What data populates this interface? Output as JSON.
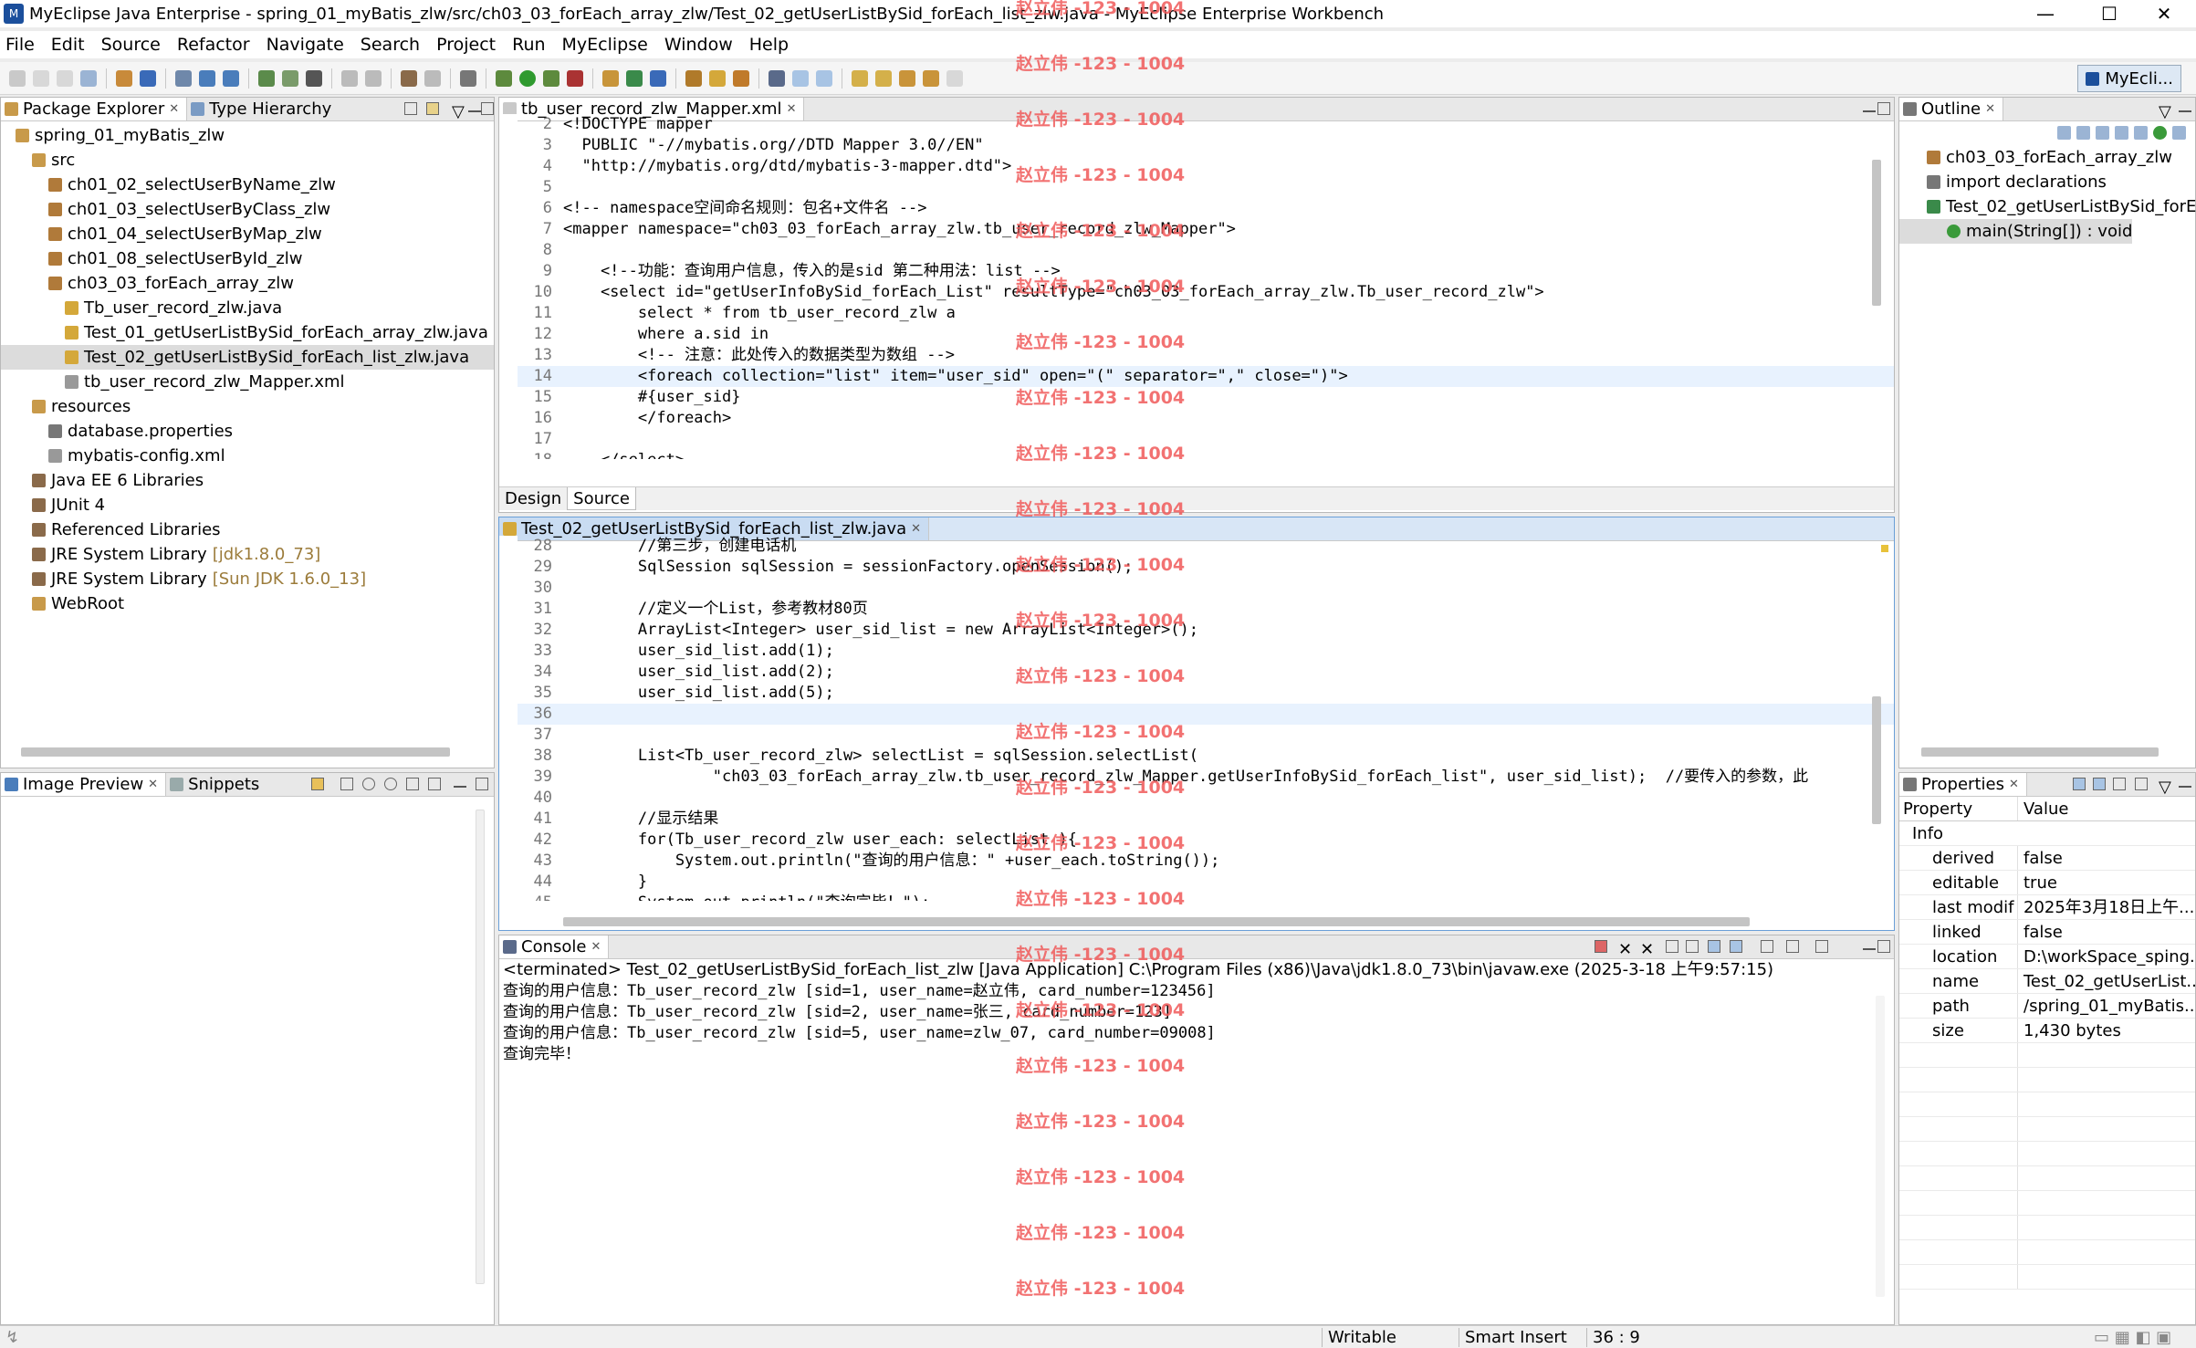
{
  "window": {
    "title": "MyEclipse Java Enterprise - spring_01_myBatis_zlw/src/ch03_03_forEach_array_zlw/Test_02_getUserListBySid_forEach_list_zlw.java - MyEclipse Enterprise Workbench",
    "minimize": "—",
    "maximize": "☐",
    "close": "✕"
  },
  "menu": [
    "File",
    "Edit",
    "Source",
    "Refactor",
    "Navigate",
    "Search",
    "Project",
    "Run",
    "MyEclipse",
    "Window",
    "Help"
  ],
  "perspective": "MyEcli...",
  "package_explorer": {
    "tabs": [
      "Package Explorer",
      "Type Hierarchy"
    ],
    "items": [
      {
        "label": "spring_01_myBatis_zlw",
        "suffix": ""
      },
      {
        "label": "src",
        "suffix": ""
      },
      {
        "label": "ch01_02_selectUserByName_zlw",
        "suffix": ""
      },
      {
        "label": "ch01_03_selectUserByClass_zlw",
        "suffix": ""
      },
      {
        "label": "ch01_04_selectUserByMap_zlw",
        "suffix": ""
      },
      {
        "label": "ch01_08_selectUserById_zlw",
        "suffix": ""
      },
      {
        "label": "ch03_03_forEach_array_zlw",
        "suffix": ""
      },
      {
        "label": "Tb_user_record_zlw.java",
        "suffix": ""
      },
      {
        "label": "Test_01_getUserListBySid_forEach_array_zlw.java",
        "suffix": ""
      },
      {
        "label": "Test_02_getUserListBySid_forEach_list_zlw.java",
        "suffix": ""
      },
      {
        "label": "tb_user_record_zlw_Mapper.xml",
        "suffix": ""
      },
      {
        "label": "resources",
        "suffix": ""
      },
      {
        "label": "database.properties",
        "suffix": ""
      },
      {
        "label": "mybatis-config.xml",
        "suffix": ""
      },
      {
        "label": "Java EE 6 Libraries",
        "suffix": ""
      },
      {
        "label": "JUnit 4",
        "suffix": ""
      },
      {
        "label": "Referenced Libraries",
        "suffix": ""
      },
      {
        "label": "JRE System Library",
        "suffix": "[jdk1.8.0_73]"
      },
      {
        "label": "JRE System Library",
        "suffix": "[Sun JDK 1.6.0_13]"
      },
      {
        "label": "WebRoot",
        "suffix": ""
      }
    ]
  },
  "image_preview": {
    "tabs": [
      "Image Preview",
      "Snippets"
    ]
  },
  "xml_editor": {
    "tab": "tb_user_record_zlw_Mapper.xml",
    "bottom_tabs": [
      "Design",
      "Source"
    ],
    "lines": [
      {
        "n": "2",
        "t": "<!DOCTYPE mapper"
      },
      {
        "n": "3",
        "t": "  PUBLIC \"-//mybatis.org//DTD Mapper 3.0//EN\""
      },
      {
        "n": "4",
        "t": "  \"http://mybatis.org/dtd/mybatis-3-mapper.dtd\">"
      },
      {
        "n": "5",
        "t": ""
      },
      {
        "n": "6",
        "t": "<!-- namespace空间命名规则：包名+文件名 -->"
      },
      {
        "n": "7",
        "t": "<mapper namespace=\"ch03_03_forEach_array_zlw.tb_user_record_zlw_Mapper\">"
      },
      {
        "n": "8",
        "t": ""
      },
      {
        "n": "9",
        "t": "    <!--功能：查询用户信息，传入的是sid 第二种用法：list -->"
      },
      {
        "n": "10",
        "t": "    <select id=\"getUserInfoBySid_forEach_List\" resultType=\"ch03_03_forEach_array_zlw.Tb_user_record_zlw\">"
      },
      {
        "n": "11",
        "t": "        select * from tb_user_record_zlw a"
      },
      {
        "n": "12",
        "t": "        where a.sid in"
      },
      {
        "n": "13",
        "t": "        <!-- 注意：此处传入的数据类型为数组 -->"
      },
      {
        "n": "14",
        "t": "        <foreach collection=\"list\" item=\"user_sid\" open=\"(\" separator=\",\" close=\")\">"
      },
      {
        "n": "15",
        "t": "        #{user_sid}"
      },
      {
        "n": "16",
        "t": "        </foreach>"
      },
      {
        "n": "17",
        "t": ""
      },
      {
        "n": "18",
        "t": "    </select>"
      }
    ]
  },
  "java_editor": {
    "tab": "Test_02_getUserListBySid_forEach_list_zlw.java",
    "lines": [
      {
        "n": "28",
        "t": "        //第三步，创建电话机"
      },
      {
        "n": "29",
        "t": "        SqlSession sqlSession = sessionFactory.openSession();"
      },
      {
        "n": "30",
        "t": ""
      },
      {
        "n": "31",
        "t": "        //定义一个List，参考教材80页"
      },
      {
        "n": "32",
        "t": "        ArrayList<Integer> user_sid_list = new ArrayList<Integer>();"
      },
      {
        "n": "33",
        "t": "        user_sid_list.add(1);"
      },
      {
        "n": "34",
        "t": "        user_sid_list.add(2);"
      },
      {
        "n": "35",
        "t": "        user_sid_list.add(5);"
      },
      {
        "n": "36",
        "t": ""
      },
      {
        "n": "37",
        "t": ""
      },
      {
        "n": "38",
        "t": "        List<Tb_user_record_zlw> selectList = sqlSession.selectList("
      },
      {
        "n": "39",
        "t": "                \"ch03_03_forEach_array_zlw.tb_user_record_zlw_Mapper.getUserInfoBySid_forEach_list\", user_sid_list);  //要传入的参数，此"
      },
      {
        "n": "40",
        "t": ""
      },
      {
        "n": "41",
        "t": "        //显示结果"
      },
      {
        "n": "42",
        "t": "        for(Tb_user_record_zlw user_each: selectList ){"
      },
      {
        "n": "43",
        "t": "            System.out.println(\"查询的用户信息：\" +user_each.toString());"
      },
      {
        "n": "44",
        "t": "        }"
      },
      {
        "n": "45",
        "t": "        System.out.println(\"查询完毕！\");"
      }
    ]
  },
  "console": {
    "tab": "Console",
    "header": "<terminated> Test_02_getUserListBySid_forEach_list_zlw [Java Application] C:\\Program Files (x86)\\Java\\jdk1.8.0_73\\bin\\javaw.exe (2025-3-18 上午9:57:15)",
    "lines": [
      "查询的用户信息：Tb_user_record_zlw [sid=1, user_name=赵立伟, card_number=123456]",
      "查询的用户信息：Tb_user_record_zlw [sid=2, user_name=张三, card_number=123]",
      "查询的用户信息：Tb_user_record_zlw [sid=5, user_name=zlw_07, card_number=09008]",
      "查询完毕！"
    ]
  },
  "outline": {
    "tab": "Outline",
    "items": [
      "ch03_03_forEach_array_zlw",
      "import declarations",
      "Test_02_getUserListBySid_forEa",
      "main(String[]) : void"
    ]
  },
  "properties": {
    "tab": "Properties",
    "col_property": "Property",
    "col_value": "Value",
    "group": "Info",
    "rows": [
      {
        "k": "derived",
        "v": "false"
      },
      {
        "k": "editable",
        "v": "true"
      },
      {
        "k": "last modif",
        "v": "2025年3月18日上午..."
      },
      {
        "k": "linked",
        "v": "false"
      },
      {
        "k": "location",
        "v": "D:\\workSpace_sping..."
      },
      {
        "k": "name",
        "v": "Test_02_getUserList..."
      },
      {
        "k": "path",
        "v": "/spring_01_myBatis..."
      },
      {
        "k": "size",
        "v": "1,430  bytes"
      }
    ]
  },
  "status": {
    "writable": "Writable",
    "insert": "Smart Insert",
    "position": "36 : 9"
  },
  "watermark": "赵立伟 -123 - 1004"
}
